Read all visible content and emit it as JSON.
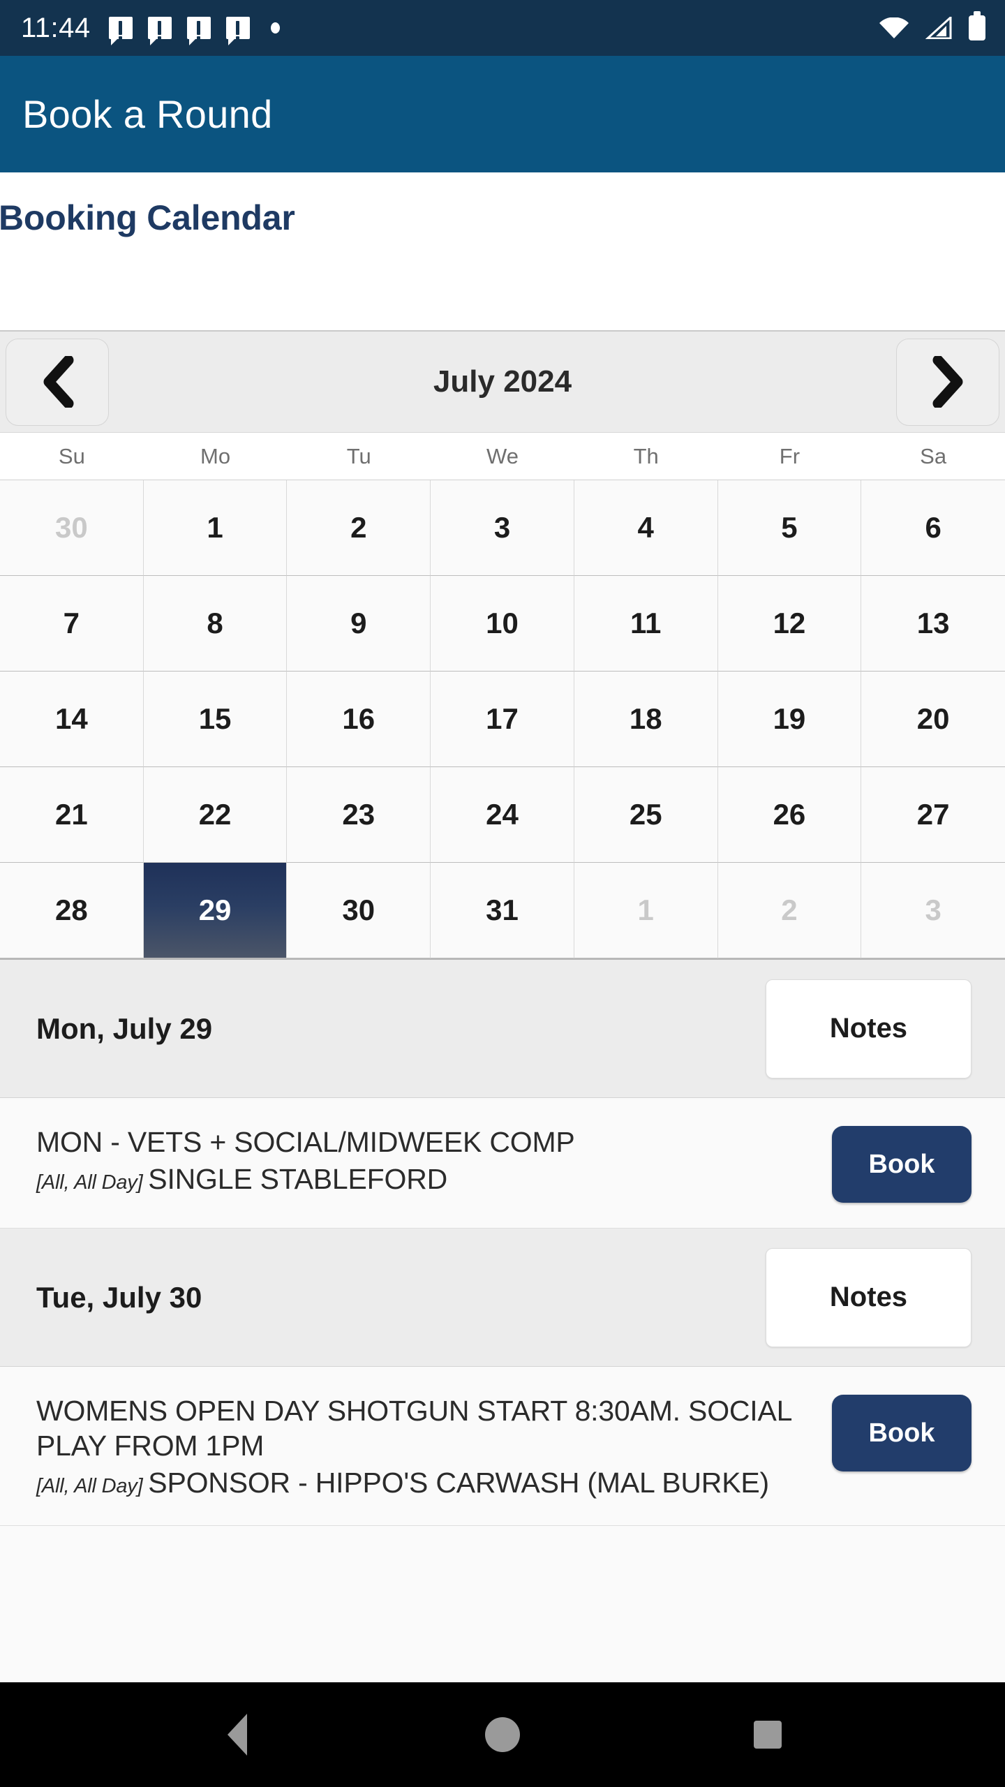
{
  "status_bar": {
    "time": "11:44",
    "notification_count": 4,
    "notification_icon": "chat-alert-icon",
    "extra_dot_icon": "dot-icon",
    "wifi_icon": "wifi-icon",
    "signal_icon": "cell-signal-icon",
    "battery_icon": "battery-full-icon",
    "background_color": "#13334f"
  },
  "app_bar": {
    "title": "Book a Round",
    "background_color": "#0b5480"
  },
  "page": {
    "title": "Booking Calendar",
    "title_color": "#1e3a63"
  },
  "calendar": {
    "prev_icon": "chevron-left-icon",
    "next_icon": "chevron-right-icon",
    "month_label": "July 2024",
    "weekdays": [
      "Su",
      "Mo",
      "Tu",
      "We",
      "Th",
      "Fr",
      "Sa"
    ],
    "selected_day": "29",
    "selected_color": "#1f3159",
    "weeks": [
      [
        {
          "day": "30",
          "muted": true
        },
        {
          "day": "1",
          "muted": false
        },
        {
          "day": "2",
          "muted": false
        },
        {
          "day": "3",
          "muted": false
        },
        {
          "day": "4",
          "muted": false
        },
        {
          "day": "5",
          "muted": false
        },
        {
          "day": "6",
          "muted": false
        }
      ],
      [
        {
          "day": "7",
          "muted": false
        },
        {
          "day": "8",
          "muted": false
        },
        {
          "day": "9",
          "muted": false
        },
        {
          "day": "10",
          "muted": false
        },
        {
          "day": "11",
          "muted": false
        },
        {
          "day": "12",
          "muted": false
        },
        {
          "day": "13",
          "muted": false
        }
      ],
      [
        {
          "day": "14",
          "muted": false
        },
        {
          "day": "15",
          "muted": false
        },
        {
          "day": "16",
          "muted": false
        },
        {
          "day": "17",
          "muted": false
        },
        {
          "day": "18",
          "muted": false
        },
        {
          "day": "19",
          "muted": false
        },
        {
          "day": "20",
          "muted": false
        }
      ],
      [
        {
          "day": "21",
          "muted": false
        },
        {
          "day": "22",
          "muted": false
        },
        {
          "day": "23",
          "muted": false
        },
        {
          "day": "24",
          "muted": false
        },
        {
          "day": "25",
          "muted": false
        },
        {
          "day": "26",
          "muted": false
        },
        {
          "day": "27",
          "muted": false
        }
      ],
      [
        {
          "day": "28",
          "muted": false
        },
        {
          "day": "29",
          "muted": false,
          "selected": true
        },
        {
          "day": "30",
          "muted": false
        },
        {
          "day": "31",
          "muted": false
        },
        {
          "day": "1",
          "muted": true
        },
        {
          "day": "2",
          "muted": true
        },
        {
          "day": "3",
          "muted": true
        }
      ]
    ]
  },
  "day_sections": [
    {
      "date_label": "Mon, July 29",
      "notes_label": "Notes",
      "events": [
        {
          "title": "MON - VETS + SOCIAL/MIDWEEK COMP",
          "time_tag": "[All, All Day]",
          "subtitle": "SINGLE STABLEFORD",
          "book_label": "Book"
        }
      ]
    },
    {
      "date_label": "Tue, July 30",
      "notes_label": "Notes",
      "events": [
        {
          "title": "WOMENS OPEN DAY SHOTGUN START 8:30AM. SOCIAL PLAY FROM 1PM",
          "time_tag": "[All, All Day]",
          "subtitle": "SPONSOR - HIPPO'S CARWASH (MAL BURKE)",
          "book_label": "Book"
        }
      ]
    }
  ],
  "nav_bar": {
    "back_icon": "triangle-back-icon",
    "home_icon": "circle-home-icon",
    "recents_icon": "square-recents-icon",
    "background_color": "#000000"
  }
}
